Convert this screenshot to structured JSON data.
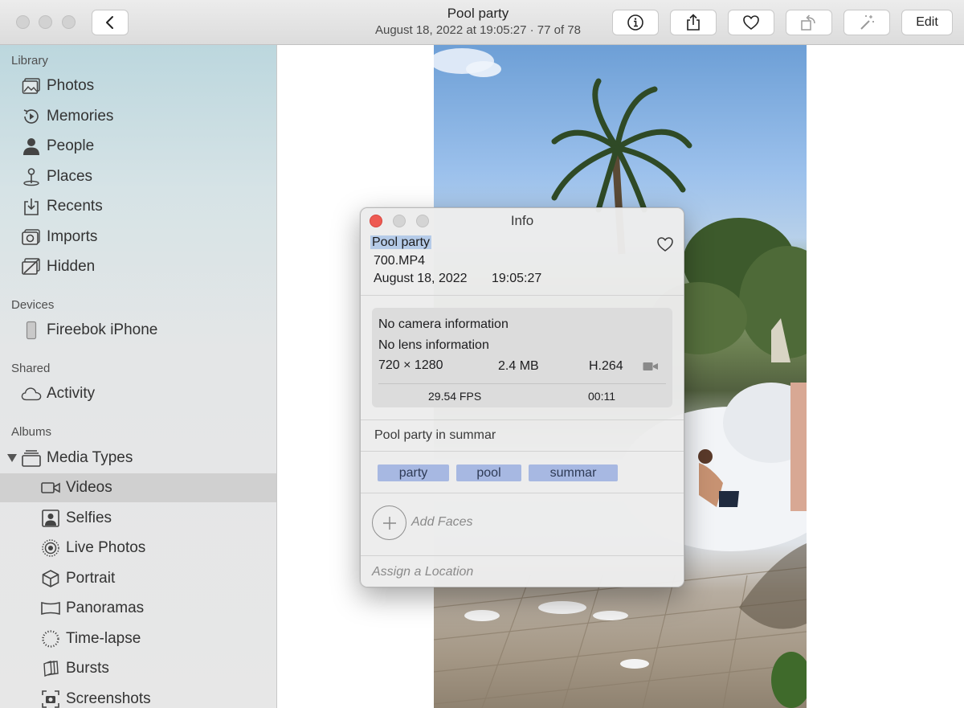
{
  "window": {
    "title": "Pool party",
    "subtitle": "August 18, 2022 at 19:05:27  ·  77 of 78",
    "edit_label": "Edit"
  },
  "toolbar": {
    "icons": [
      "back-chevron-icon",
      "info-icon",
      "share-icon",
      "heart-icon",
      "rotate-icon",
      "magic-wand-icon"
    ]
  },
  "sidebar": {
    "library_header": "Library",
    "library_items": [
      {
        "label": "Photos",
        "icon": "photos-icon"
      },
      {
        "label": "Memories",
        "icon": "memories-icon"
      },
      {
        "label": "People",
        "icon": "person-icon"
      },
      {
        "label": "Places",
        "icon": "pin-icon"
      },
      {
        "label": "Recents",
        "icon": "download-tray-icon"
      },
      {
        "label": "Imports",
        "icon": "camera-icon"
      },
      {
        "label": "Hidden",
        "icon": "hidden-icon"
      }
    ],
    "devices_header": "Devices",
    "devices_items": [
      {
        "label": "Fireebok iPhone",
        "icon": "iphone-icon"
      }
    ],
    "shared_header": "Shared",
    "shared_items": [
      {
        "label": "Activity",
        "icon": "cloud-icon"
      }
    ],
    "albums_header": "Albums",
    "media_types_label": "Media Types",
    "media_items": [
      {
        "label": "Videos",
        "icon": "video-camera-icon",
        "selected": true
      },
      {
        "label": "Selfies",
        "icon": "selfie-icon"
      },
      {
        "label": "Live Photos",
        "icon": "live-photo-icon"
      },
      {
        "label": "Portrait",
        "icon": "cube-icon"
      },
      {
        "label": "Panoramas",
        "icon": "panorama-icon"
      },
      {
        "label": "Time-lapse",
        "icon": "timelapse-icon"
      },
      {
        "label": "Bursts",
        "icon": "bursts-icon"
      },
      {
        "label": "Screenshots",
        "icon": "screenshot-icon"
      }
    ]
  },
  "info_panel": {
    "title": "Info",
    "photo_title": "Pool party",
    "filename": "700.MP4",
    "date": "August 18, 2022",
    "time": "19:05:27",
    "camera": "No camera information",
    "lens": "No lens information",
    "resolution": "720 × 1280",
    "size": "2.4 MB",
    "codec": "H.264",
    "fps": "29.54 FPS",
    "duration": "00:11",
    "caption": "Pool party in summar",
    "keywords": [
      "party",
      "pool",
      "summar"
    ],
    "add_faces": "Add Faces",
    "assign_location": "Assign a Location"
  },
  "colors": {
    "close_red": "#ee5a52",
    "keyword_blue": "#a7b8e2",
    "selection_blue": "#b5cbe8",
    "sidebar_selected": "#d0d0d0"
  }
}
